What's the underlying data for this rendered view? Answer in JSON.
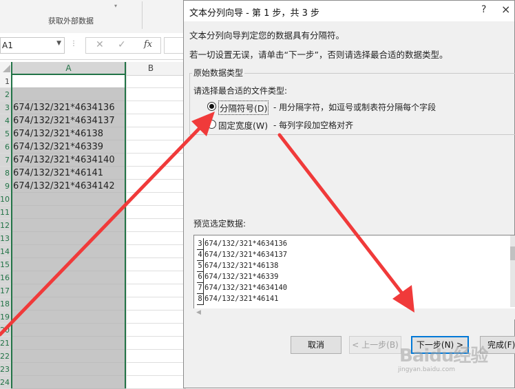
{
  "excel": {
    "ribbon_group_label": "获取外部数据",
    "namebox_value": "A1",
    "fx_label": "fx",
    "col_headers": [
      "A",
      "B"
    ],
    "row_numbers": [
      "1",
      "2",
      "3",
      "4",
      "5",
      "6",
      "7",
      "8",
      "9",
      "10",
      "11",
      "12",
      "13",
      "14",
      "15",
      "16",
      "17",
      "18",
      "19",
      "20",
      "21",
      "22",
      "23",
      "24"
    ],
    "cells_a": [
      "",
      "",
      "674/132/321*4634136",
      "674/132/321*4634137",
      "674/132/321*46138",
      "674/132/321*46339",
      "674/132/321*4634140",
      "674/132/321*46141",
      "674/132/321*4634142",
      "",
      "",
      "",
      "",
      "",
      "",
      "",
      "",
      "",
      "",
      "",
      "",
      "",
      "",
      ""
    ]
  },
  "dialog": {
    "title": "文本分列向导 - 第 1 步，共 3 步",
    "help": "?",
    "close": "×",
    "intro1": "文本分列向导判定您的数据具有分隔符。",
    "intro2": "若一切设置无误，请单击“下一步”，否则请选择最合适的数据类型。",
    "group_label": "原始数据类型",
    "type_prompt": "请选择最合适的文件类型:",
    "option1": {
      "label": "分隔符号(D)",
      "desc": "- 用分隔字符，如逗号或制表符分隔每个字段",
      "selected": true
    },
    "option2": {
      "label": "固定宽度(W)",
      "desc": "- 每列字段加空格对齐",
      "selected": false
    },
    "preview_label": "预览选定数据:",
    "preview_rows": [
      {
        "num": "3",
        "text": "674/132/321*4634136"
      },
      {
        "num": "4",
        "text": "674/132/321*4634137"
      },
      {
        "num": "5",
        "text": "674/132/321*46138"
      },
      {
        "num": "6",
        "text": "674/132/321*46339"
      },
      {
        "num": "7",
        "text": "674/132/321*4634140"
      },
      {
        "num": "8",
        "text": "674/132/321*46141"
      }
    ],
    "buttons": {
      "cancel": "取消",
      "back": "< 上一步(B)",
      "next": "下一步(N) >",
      "finish": "完成(F)"
    }
  },
  "watermark": {
    "text": "Baidu经验",
    "sub": "jingyan.baidu.com"
  },
  "colors": {
    "excel_green": "#217346",
    "arrow_red": "#f03a3a",
    "selection_gray": "#c6c6c6"
  }
}
